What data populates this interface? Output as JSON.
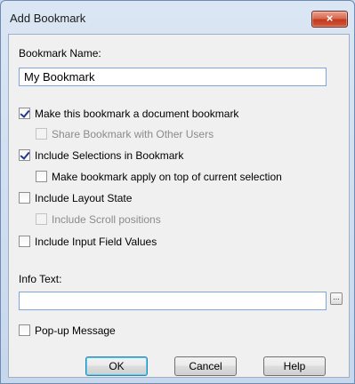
{
  "window": {
    "title": "Add Bookmark",
    "close_glyph": "×"
  },
  "bookmark_name": {
    "label": "Bookmark Name:",
    "value": "My Bookmark"
  },
  "options": {
    "document_bookmark": {
      "label": "Make this bookmark a document bookmark",
      "checked": true,
      "enabled": true
    },
    "share_bookmark": {
      "label": "Share Bookmark with Other Users",
      "checked": false,
      "enabled": false
    },
    "include_selections": {
      "label": "Include Selections in Bookmark",
      "checked": true,
      "enabled": true
    },
    "apply_on_top": {
      "label": "Make bookmark apply on top of current selection",
      "checked": false,
      "enabled": true
    },
    "include_layout": {
      "label": "Include Layout State",
      "checked": false,
      "enabled": true
    },
    "include_scroll": {
      "label": "Include Scroll positions",
      "checked": false,
      "enabled": false
    },
    "include_input_fields": {
      "label": "Include Input Field Values",
      "checked": false,
      "enabled": true
    }
  },
  "info_text": {
    "label": "Info Text:",
    "value": "",
    "browse_label": "..."
  },
  "popup_message": {
    "label": "Pop-up Message",
    "checked": false,
    "enabled": true
  },
  "buttons": {
    "ok": "OK",
    "cancel": "Cancel",
    "help": "Help"
  },
  "colors": {
    "check_mark": "#24378c",
    "close_button": "#c2391c",
    "default_button_glow": "#48d4f7"
  }
}
